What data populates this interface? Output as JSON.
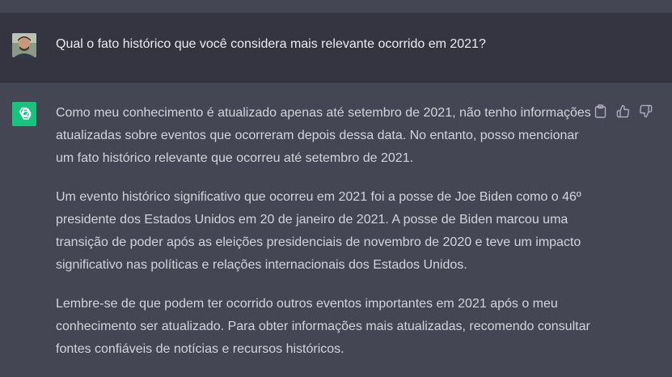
{
  "conversation": {
    "user_message": "Qual o fato histórico que você considera mais relevante ocorrido em 2021?",
    "assistant_paragraphs": [
      "Como meu conhecimento é atualizado apenas até setembro de 2021, não tenho informações atualizadas sobre eventos que ocorreram depois dessa data. No entanto, posso mencionar um fato histórico relevante que ocorreu até setembro de 2021.",
      "Um evento histórico significativo que ocorreu em 2021 foi a posse de Joe Biden como o 46º presidente dos Estados Unidos em 20 de janeiro de 2021. A posse de Biden marcou uma transição de poder após as eleições presidenciais de novembro de 2020 e teve um impacto significativo nas políticas e relações internacionais dos Estados Unidos.",
      "Lembre-se de que podem ter ocorrido outros eventos importantes em 2021 após o meu conhecimento ser atualizado. Para obter informações mais atualizadas, recomendo consultar fontes confiáveis de notícias e recursos históricos."
    ]
  },
  "icons": {
    "user_avatar": "avatar",
    "assistant_logo": "openai-logo-icon",
    "copy": "clipboard-icon",
    "like": "thumbs-up-icon",
    "dislike": "thumbs-down-icon"
  },
  "colors": {
    "user_bg": "#343541",
    "assistant_bg": "#444654",
    "logo_bg": "#19c37d",
    "text": "#d1d5db"
  }
}
